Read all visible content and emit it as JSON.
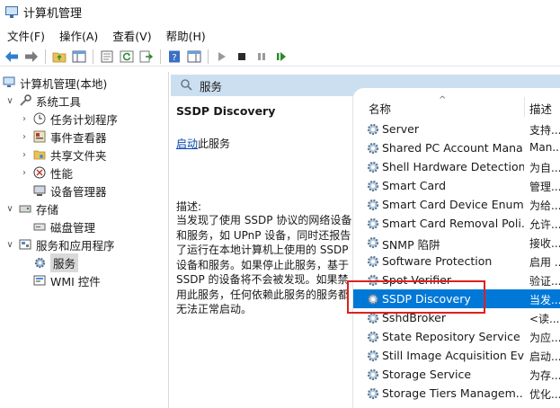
{
  "window": {
    "title": "计算机管理"
  },
  "menubar": {
    "items": [
      "文件(F)",
      "操作(A)",
      "查看(V)",
      "帮助(H)"
    ]
  },
  "tree": {
    "root": "计算机管理(本地)",
    "system_tools": "系统工具",
    "task_scheduler": "任务计划程序",
    "event_viewer": "事件查看器",
    "shared_folders": "共享文件夹",
    "performance": "性能",
    "device_manager": "设备管理器",
    "storage": "存储",
    "disk_management": "磁盘管理",
    "services_apps": "服务和应用程序",
    "services": "服务",
    "wmi": "WMI 控件"
  },
  "middle": {
    "header": "服务",
    "service_title": "SSDP Discovery",
    "start_link": "启动",
    "start_suffix": "此服务",
    "desc_label": "描述:",
    "desc_text": "当发现了使用 SSDP 协议的网络设备和服务，如 UPnP 设备，同时还报告了运行在本地计算机上使用的 SSDP 设备和服务。如果停止此服务，基于 SSDP 的设备将不会被发现。如果禁用此服务，任何依赖此服务的服务都无法正常启动。"
  },
  "list": {
    "columns": {
      "name": "名称",
      "desc": "描述"
    },
    "rows": [
      {
        "name": "Server",
        "desc": "支持..."
      },
      {
        "name": "Shared PC Account Mana...",
        "desc": "Man..."
      },
      {
        "name": "Shell Hardware Detection",
        "desc": "为自..."
      },
      {
        "name": "Smart Card",
        "desc": "管理..."
      },
      {
        "name": "Smart Card Device Enum...",
        "desc": "为给..."
      },
      {
        "name": "Smart Card Removal Poli...",
        "desc": "允许..."
      },
      {
        "name": "SNMP 陷阱",
        "desc": "接收..."
      },
      {
        "name": "Software Protection",
        "desc": "启用 ..."
      },
      {
        "name": "Spot Verifier",
        "desc": "验证..."
      },
      {
        "name": "SSDP Discovery",
        "desc": "当发..."
      },
      {
        "name": "SshdBroker",
        "desc": "<读..."
      },
      {
        "name": "State Repository Service",
        "desc": "为应..."
      },
      {
        "name": "Still Image Acquisition Ev...",
        "desc": "启动..."
      },
      {
        "name": "Storage Service",
        "desc": "为存..."
      },
      {
        "name": "Storage Tiers Managem...",
        "desc": "优化..."
      }
    ],
    "selected_index": 9
  },
  "colors": {
    "selection": "#0078d7",
    "highlight_box": "#e0201c",
    "header_band": "#ccdff0"
  }
}
